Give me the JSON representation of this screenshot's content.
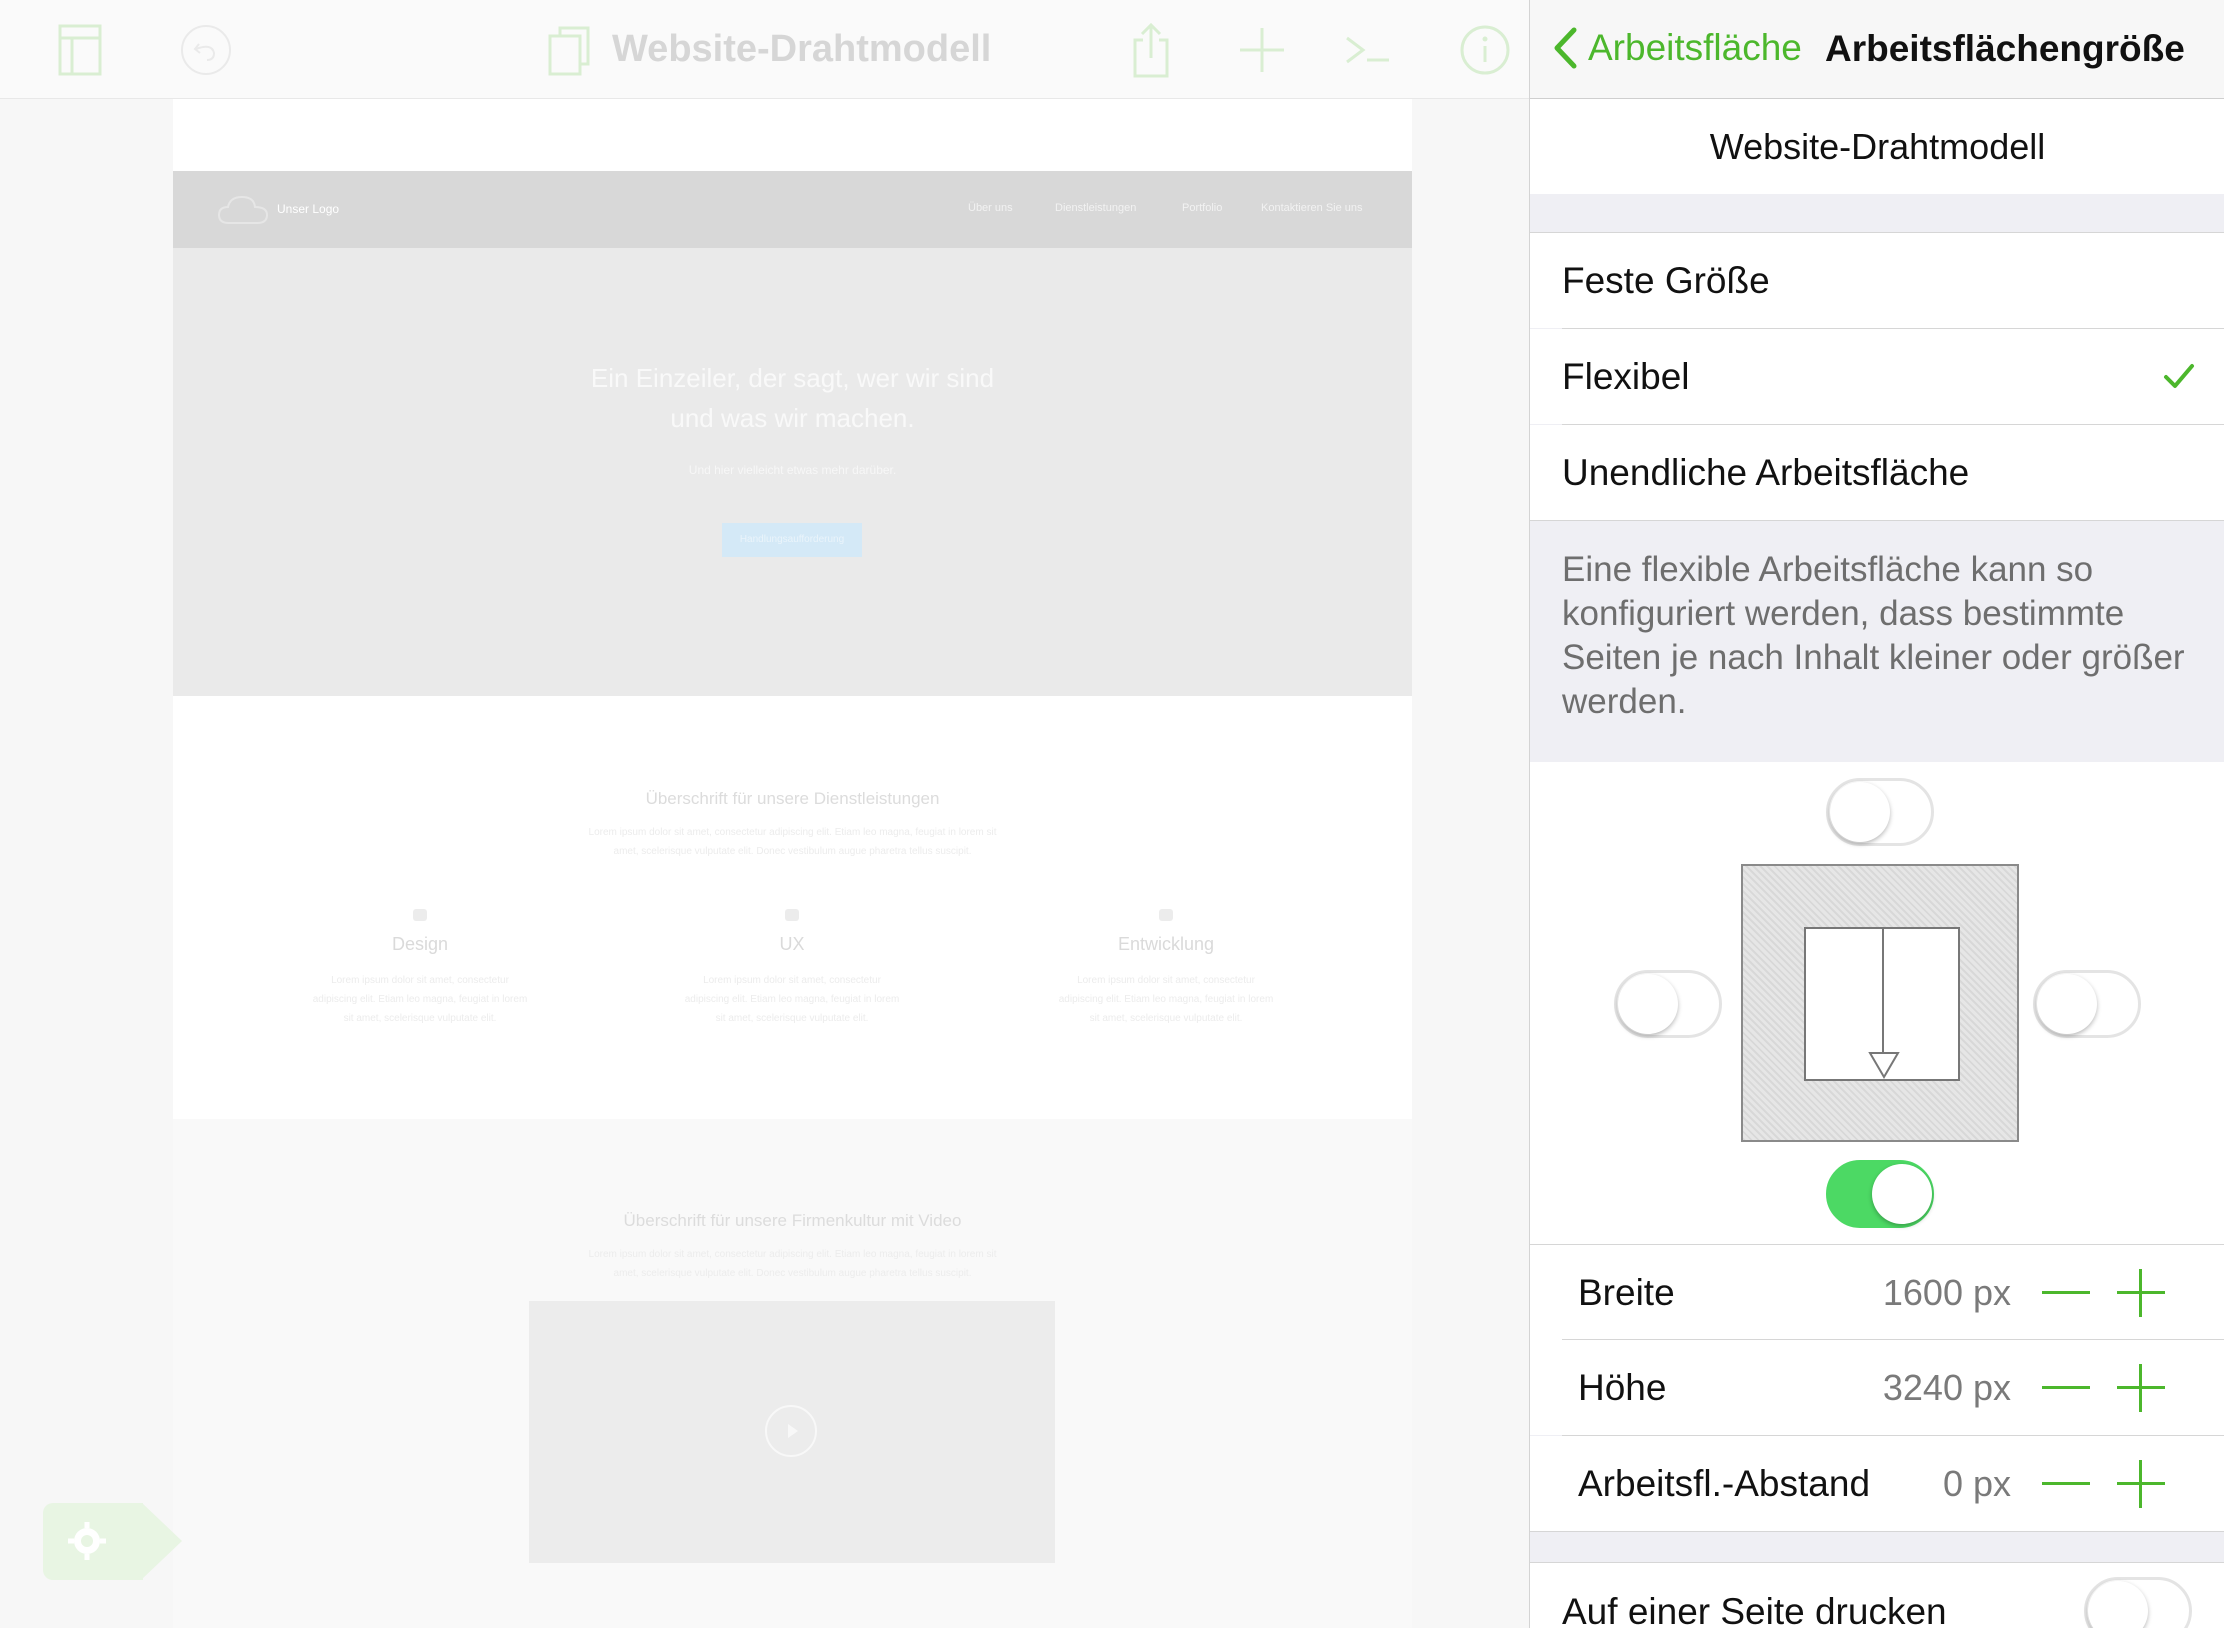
{
  "toolbar": {
    "title": "Website-Drahtmodell",
    "icons": [
      "sidebar-icon",
      "undo-icon",
      "document-icon",
      "share-icon",
      "add-icon",
      "terminal-icon",
      "info-icon"
    ]
  },
  "wireframe": {
    "logo_text": "Unser Logo",
    "nav": [
      "Über uns",
      "Dienstleistungen",
      "Portfolio",
      "Kontaktieren Sie uns"
    ],
    "hero_title_line1": "Ein Einzeiler, der sagt, wer wir sind",
    "hero_title_line2": "und was wir machen.",
    "hero_sub": "Und hier vielleicht etwas mehr darüber.",
    "hero_button": "Handlungsaufforderung",
    "services_heading": "Überschrift für unsere Dienstleistungen",
    "services_lorem_1": "Lorem ipsum dolor sit amet, consectetur adipiscing elit. Etiam leo magna, feugiat in lorem sit",
    "services_lorem_2": "amet, scelerisque vulputate elit. Donec vestibulum augue pharetra tellus suscipit.",
    "columns": [
      {
        "title": "Design",
        "icon": "palette-icon"
      },
      {
        "title": "UX",
        "icon": "grid-icon"
      },
      {
        "title": "Entwicklung",
        "icon": "window-icon"
      }
    ],
    "col_lorem_1": "Lorem ipsum dolor sit amet, consectetur",
    "col_lorem_2": "adipiscing elit. Etiam leo magna, feugiat in lorem",
    "col_lorem_3": "sit amet, scelerisque vulputate elit.",
    "culture_heading": "Überschrift für unsere Firmenkultur mit Video",
    "culture_lorem_1": "Lorem ipsum dolor sit amet, consectetur adipiscing elit. Etiam leo magna, feugiat in lorem sit",
    "culture_lorem_2": "amet, scelerisque vulputate elit. Donec vestibulum augue pharetra tellus suscipit."
  },
  "panel": {
    "back_label": "Arbeitsfläche",
    "title": "Arbeitsflächengröße",
    "document_name": "Website-Drahtmodell",
    "options": [
      {
        "label": "Feste Größe",
        "selected": false
      },
      {
        "label": "Flexibel",
        "selected": true
      },
      {
        "label": "Unendliche Arbeitsfläche",
        "selected": false
      }
    ],
    "description": "Eine flexible Arbeitsfläche kann so konfiguriert werden, dass bestimmte Seiten je nach Inhalt kleiner oder größer werden.",
    "growth_toggles": {
      "top": false,
      "left": false,
      "right": false,
      "bottom": true
    },
    "fields": [
      {
        "label": "Breite",
        "value": "1600 px"
      },
      {
        "label": "Höhe",
        "value": "3240 px"
      },
      {
        "label": "Arbeitsfl.-Abstand",
        "value": "0 px"
      }
    ],
    "print_label": "Auf einer Seite drucken",
    "print_on_one_page": false
  },
  "colors": {
    "accent": "#4cb72c",
    "toggle_on": "#4cd964",
    "group_background": "#efeff4"
  }
}
